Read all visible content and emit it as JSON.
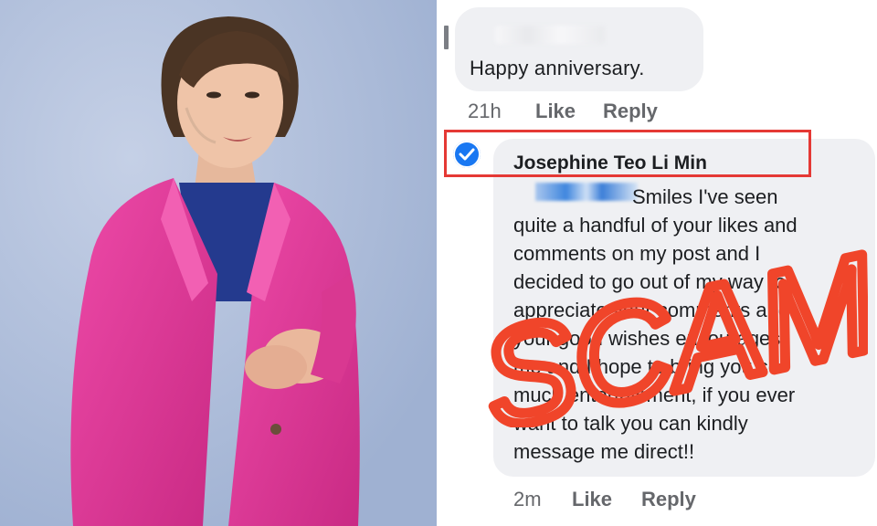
{
  "top_comment": {
    "text": "Happy anniversary.",
    "time": "21h",
    "like_label": "Like",
    "reply_label": "Reply"
  },
  "main_comment": {
    "author": "Josephine Teo Li Min",
    "text": "Smiles I've seen\nquite a handful of your likes and\ncomments on my post and I\ndecided to go out of my way to\nappreciate your comments and\nyour good wishes encourages\nme and I hope to bring you so\nmuch entertainment, if you ever\nwant to talk you can kindly\nmessage me direct!!",
    "time": "2m",
    "like_label": "Like",
    "reply_label": "Reply",
    "verified_icon": "verified-check-icon"
  },
  "overlay": {
    "stamp_text": "SCAM",
    "stamp_color": "#f0452a",
    "highlight_color": "#e53935"
  },
  "colors": {
    "bubble": "#eff0f3",
    "meta_text": "#65676b",
    "jacket": "#e13b9a",
    "backdrop": "#b9c7df"
  }
}
